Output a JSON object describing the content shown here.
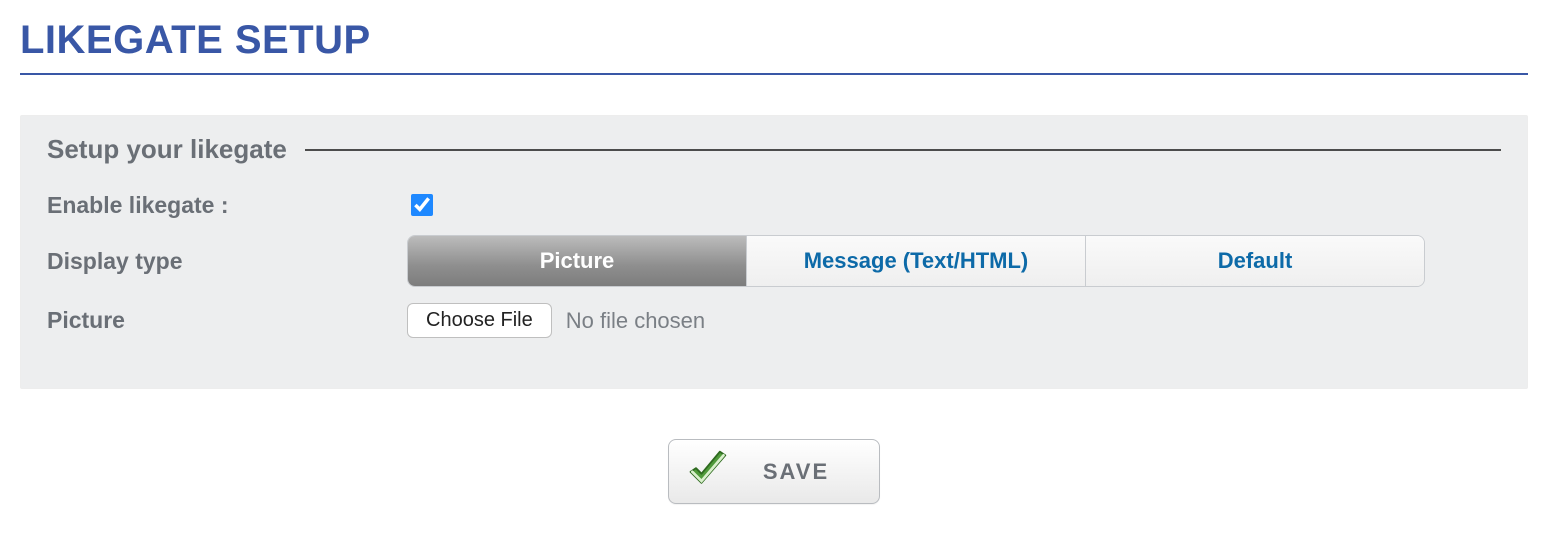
{
  "page": {
    "title": "LIKEGATE SETUP"
  },
  "panel": {
    "legend": "Setup your likegate",
    "enable": {
      "label": "Enable likegate :",
      "checked": true
    },
    "display_type": {
      "label": "Display type",
      "options": [
        "Picture",
        "Message (Text/HTML)",
        "Default"
      ],
      "active_index": 0
    },
    "picture": {
      "label": "Picture",
      "choose_label": "Choose File",
      "file_status": "No file chosen"
    }
  },
  "actions": {
    "save_label": "SAVE"
  }
}
